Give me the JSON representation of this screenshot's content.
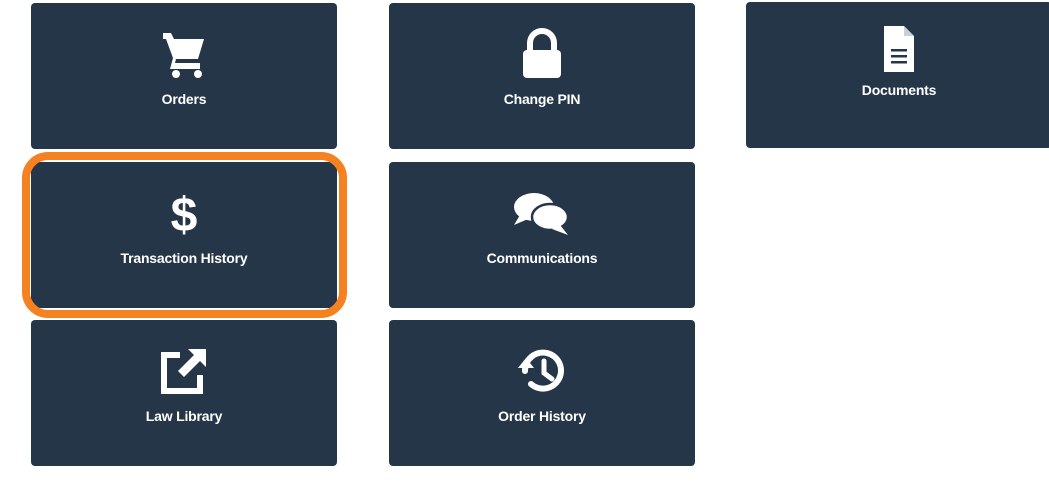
{
  "tiles": {
    "orders": {
      "label": "Orders",
      "icon": "cart-icon"
    },
    "change_pin": {
      "label": "Change PIN",
      "icon": "lock-icon"
    },
    "documents": {
      "label": "Documents",
      "icon": "document-icon"
    },
    "transaction_history": {
      "label": "Transaction History",
      "icon": "dollar-icon"
    },
    "communications": {
      "label": "Communications",
      "icon": "comments-icon"
    },
    "law_library": {
      "label": "Law Library",
      "icon": "external-link-icon"
    },
    "order_history": {
      "label": "Order History",
      "icon": "history-icon"
    }
  },
  "colors": {
    "tile_background": "#253649",
    "tile_text": "#ffffff",
    "highlight": "#f58220"
  },
  "highlighted_tile": "transaction_history"
}
